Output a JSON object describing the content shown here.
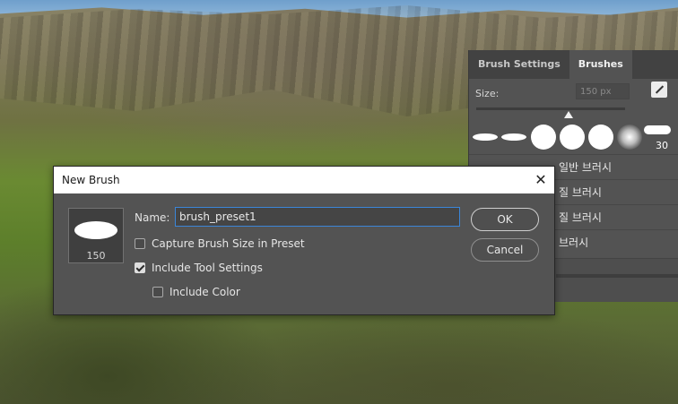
{
  "panel": {
    "tabs": [
      {
        "label": "Brush Settings",
        "active": false
      },
      {
        "label": "Brushes",
        "active": true
      }
    ],
    "size_label": "Size:",
    "size_value": "150 px",
    "brush_tips_last_number": "30",
    "list_rows": [
      {
        "label": "일반 브러시"
      },
      {
        "label": "질 브러시"
      },
      {
        "label": "질 브러시"
      },
      {
        "label": "브러시"
      }
    ]
  },
  "dialog": {
    "title": "New Brush",
    "preview_size": "150",
    "name_label": "Name:",
    "name_value": "brush_preset1",
    "options": [
      {
        "label": "Capture Brush Size in Preset",
        "checked": false
      },
      {
        "label": "Include Tool Settings",
        "checked": true
      },
      {
        "label": "Include Color",
        "checked": false
      }
    ],
    "ok_label": "OK",
    "cancel_label": "Cancel",
    "close_symbol": "✕"
  },
  "colors": {
    "panel_bg": "#535353",
    "dialog_bg": "#535353",
    "accent_focus": "#3b86d8"
  }
}
